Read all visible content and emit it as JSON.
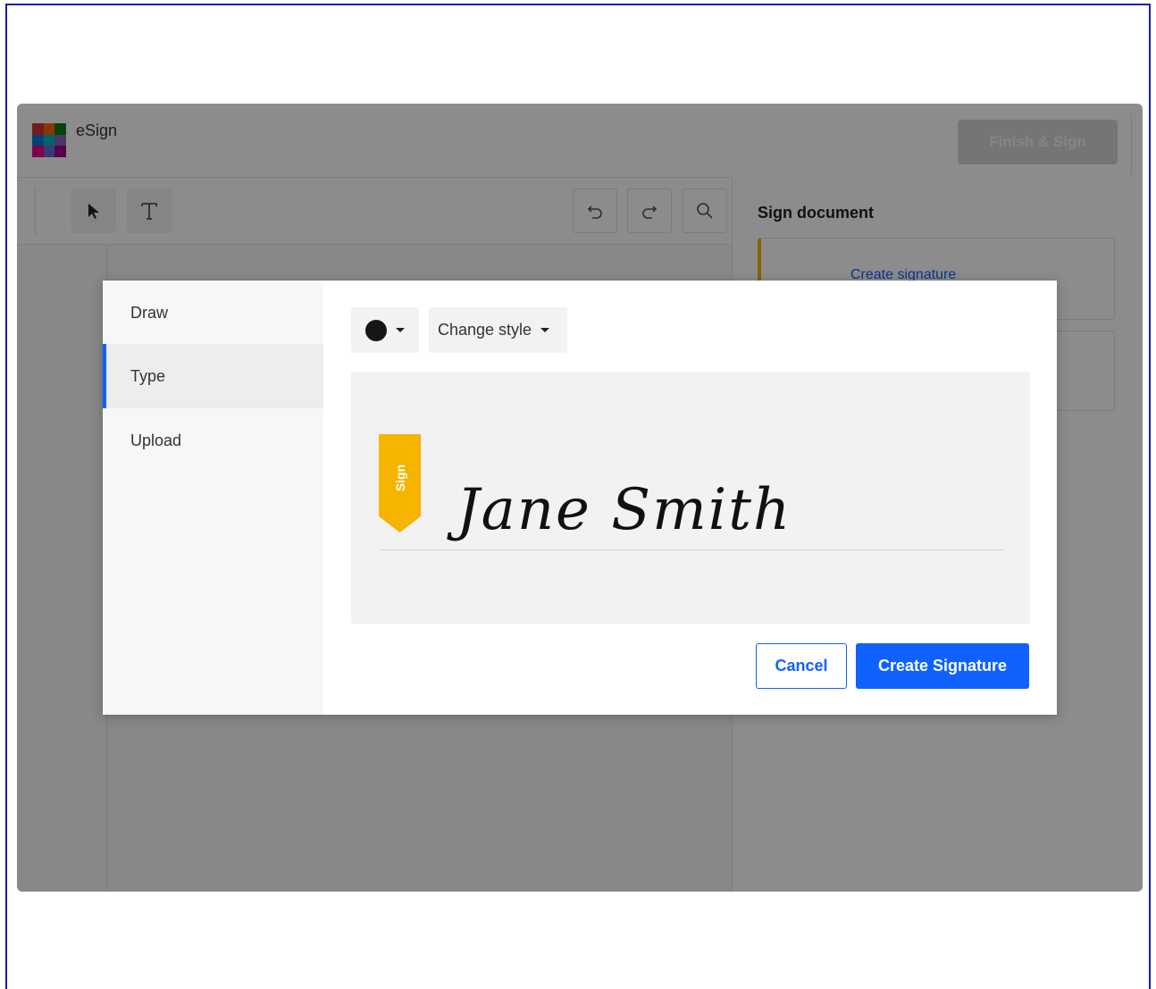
{
  "app": {
    "title": "eSign",
    "logo_colors": [
      "#d13438",
      "#f7630c",
      "#107c10",
      "#0078d4",
      "#00b7c3",
      "#8764b8",
      "#e3008c",
      "#6b69d6",
      "#9a0089"
    ],
    "finish_label": "Finish & Sign"
  },
  "toolbar": {
    "tools": [
      {
        "name": "select-tool",
        "icon": "pointer-icon"
      },
      {
        "name": "text-tool",
        "icon": "text-icon"
      }
    ],
    "actions": [
      {
        "name": "undo-button",
        "icon": "undo-icon"
      },
      {
        "name": "redo-button",
        "icon": "redo-icon"
      },
      {
        "name": "zoom-button",
        "icon": "search-icon"
      }
    ]
  },
  "side_panel": {
    "title": "Sign document",
    "create_signature_link": "Create signature"
  },
  "modal": {
    "tabs": [
      {
        "label": "Draw",
        "active": false
      },
      {
        "label": "Type",
        "active": true
      },
      {
        "label": "Upload",
        "active": false
      }
    ],
    "color": "#161616",
    "style_label": "Change style",
    "sign_tag": "Sign",
    "signature_text": "Jane Smith",
    "cancel_label": "Cancel",
    "create_label": "Create Signature",
    "accent": "#0f62fe",
    "tag_color": "#f5b400"
  }
}
